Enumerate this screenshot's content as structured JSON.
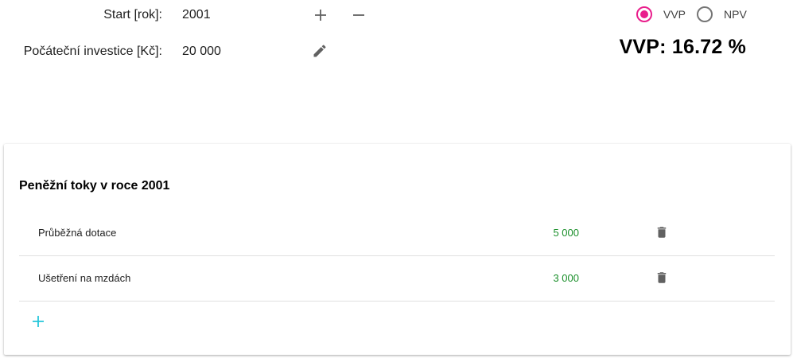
{
  "form": {
    "start_label": "Start [rok]:",
    "start_value": "2001",
    "investment_label": "Počáteční investice [Kč]:",
    "investment_value": "20 000"
  },
  "mode": {
    "options": [
      "VVP",
      "NPV"
    ],
    "selected": "VVP",
    "accent_color": "#e91e8c"
  },
  "result": {
    "text": "VVP: 16.72 %"
  },
  "cashflows": {
    "title": "Peněžní toky v roce 2001",
    "rows": [
      {
        "name": "Průběžná dotace",
        "amount": "5 000"
      },
      {
        "name": "Ušetření na mzdách",
        "amount": "3 000"
      }
    ],
    "amount_color": "#1a8f2a",
    "add_icon_color": "#26c6da"
  },
  "icons": {
    "plus": "plus-icon",
    "minus": "minus-icon",
    "edit": "pencil-icon",
    "delete": "trash-icon",
    "add": "add-icon"
  }
}
